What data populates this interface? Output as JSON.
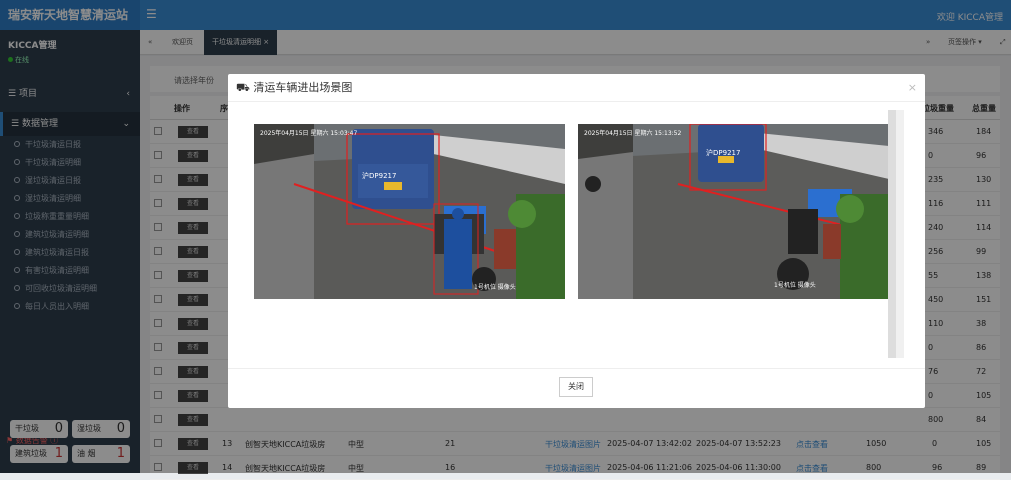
{
  "app": {
    "title": "瑞安新天地智慧清运站",
    "welcome": "欢迎 KICCA管理"
  },
  "user": {
    "name": "KICCA管理",
    "status": "在线"
  },
  "menu": {
    "project": "项目",
    "data": "数据管理",
    "items": [
      "干垃圾清运日报",
      "干垃圾清运明细",
      "湿垃圾清运日报",
      "湿垃圾清运明细",
      "垃圾称重重量明细",
      "建筑垃圾清运明细",
      "建筑垃圾清运日报",
      "有害垃圾清运明细",
      "可回收垃圾清运明细",
      "每日人员出入明细"
    ]
  },
  "alarm": {
    "title": "数据告警",
    "items": [
      {
        "label": "干垃圾",
        "count": "0"
      },
      {
        "label": "湿垃圾",
        "count": "0"
      },
      {
        "label": "建筑垃圾",
        "count": "1"
      },
      {
        "label": "油 烟",
        "count": "1"
      }
    ]
  },
  "tabs": {
    "home": "欢迎页",
    "active": "干垃圾清运明细",
    "right": "页签操作"
  },
  "toolbar": {
    "select": "请选择年份"
  },
  "table": {
    "headers": {
      "op": "操作",
      "c1": "序",
      "right1": "垃圾重量",
      "right2": "总重量"
    },
    "view_label": "查看",
    "right1": [
      "346",
      "0",
      "235",
      "116",
      "240",
      "256",
      "55",
      "450",
      "110",
      "0",
      "76",
      "0",
      "800"
    ],
    "right2": [
      "184",
      "96",
      "130",
      "111",
      "114",
      "99",
      "138",
      "151",
      "38",
      "86",
      "72",
      "105",
      "84"
    ],
    "bottom_rows": [
      {
        "no": "13",
        "name": "创智天地KICCA垃圾房",
        "size": "中型",
        "num": "21",
        "link": "干垃圾清运图片",
        "t1": "2025-04-07 13:42:02",
        "t2": "2025-04-07 13:52:23",
        "view": "点击查看",
        "w": "1050",
        "z": "0",
        "tot": "105"
      },
      {
        "no": "14",
        "name": "创智天地KICCA垃圾房",
        "size": "中型",
        "num": "16",
        "link": "干垃圾清运图片",
        "t1": "2025-04-06 11:21:06",
        "t2": "2025-04-06 11:30:00",
        "view": "点击查看",
        "w": "800",
        "z": "96",
        "tot": "89"
      }
    ]
  },
  "modal": {
    "title": "清运车辆进出场景图",
    "close": "关闭",
    "photo1": {
      "timestamp": "2025年04月15日 星期六 15:03:47",
      "plate": "沪DP9217",
      "caption": "1号机位 摄像头"
    },
    "photo2": {
      "timestamp": "2025年04月15日 星期六 15:13:52",
      "plate": "沪DP9217",
      "caption": "1号机位 摄像头"
    }
  }
}
